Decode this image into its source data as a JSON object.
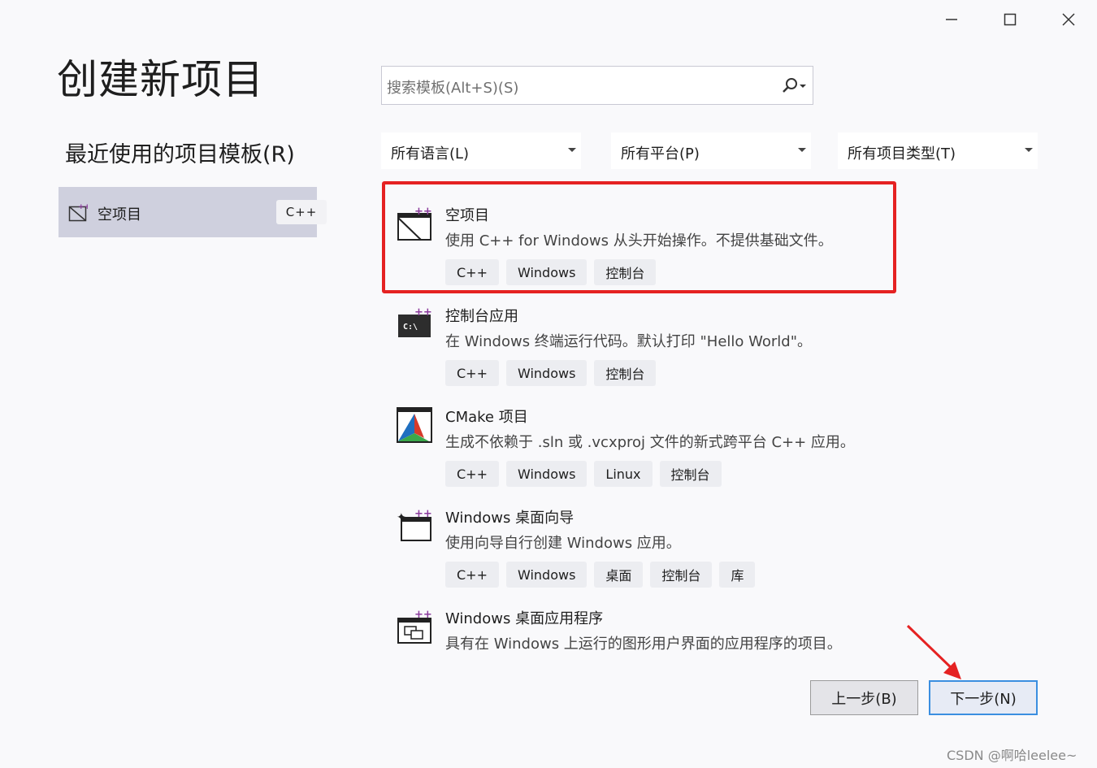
{
  "window": {
    "minimize_icon": "minimize-icon",
    "maximize_icon": "maximize-icon",
    "close_icon": "close-icon"
  },
  "page_title": "创建新项目",
  "recent": {
    "heading": "最近使用的项目模板(R)",
    "items": [
      {
        "label": "空项目",
        "tag": "C++",
        "icon": "empty-project-icon"
      }
    ]
  },
  "search": {
    "placeholder": "搜索模板(Alt+S)(S)",
    "icon": "search-icon"
  },
  "filters": [
    {
      "label": "所有语言(L)"
    },
    {
      "label": "所有平台(P)"
    },
    {
      "label": "所有项目类型(T)"
    }
  ],
  "templates": [
    {
      "name": "空项目",
      "description": "使用 C++ for Windows 从头开始操作。不提供基础文件。",
      "tags": [
        "C++",
        "Windows",
        "控制台"
      ],
      "icon": "empty-project-icon",
      "selected": true
    },
    {
      "name": "控制台应用",
      "description": "在 Windows 终端运行代码。默认打印 \"Hello World\"。",
      "tags": [
        "C++",
        "Windows",
        "控制台"
      ],
      "icon": "console-app-icon"
    },
    {
      "name": "CMake 项目",
      "description": "生成不依赖于 .sln 或 .vcxproj 文件的新式跨平台 C++ 应用。",
      "tags": [
        "C++",
        "Windows",
        "Linux",
        "控制台"
      ],
      "icon": "cmake-icon"
    },
    {
      "name": "Windows 桌面向导",
      "description": "使用向导自行创建 Windows 应用。",
      "tags": [
        "C++",
        "Windows",
        "桌面",
        "控制台",
        "库"
      ],
      "icon": "desktop-wizard-icon"
    },
    {
      "name": "Windows 桌面应用程序",
      "description": "具有在 Windows 上运行的图形用户界面的应用程序的项目。",
      "tags": [],
      "icon": "desktop-app-icon"
    }
  ],
  "buttons": {
    "back": "上一步(B)",
    "next": "下一步(N)"
  },
  "annotations": {
    "highlight_color": "#e52222",
    "arrow_color": "#e52222"
  },
  "watermark": "CSDN @啊哈leelee~"
}
